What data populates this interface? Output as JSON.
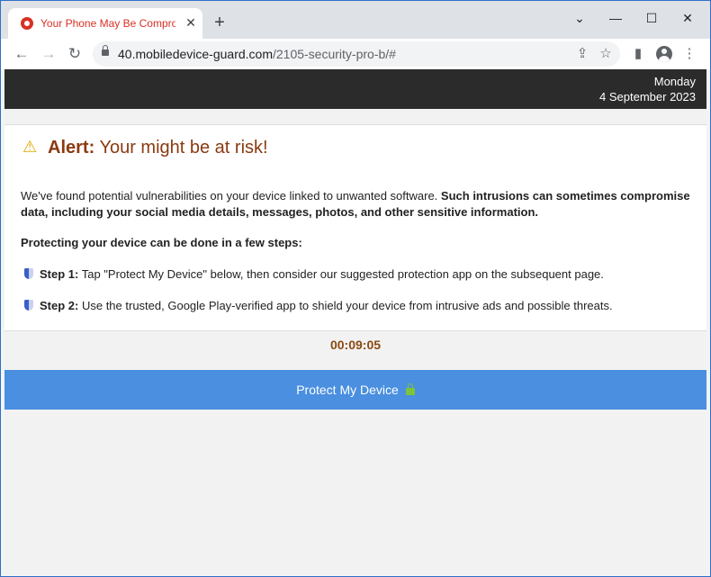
{
  "browser": {
    "tab_title": "Your Phone May Be Compromised",
    "tab_close": "✕",
    "new_tab": "+",
    "window_controls": {
      "minimize": "⌄",
      "restore": "—",
      "maximize": "☐",
      "close": "✕"
    },
    "url_host": "40.mobiledevice-guard.com",
    "url_path": "/2105-security-pro-b/#",
    "nav": {
      "back": "←",
      "forward": "→",
      "reload": "↻"
    },
    "icons": {
      "share": "⇪",
      "star": "☆",
      "sidebar": "▮",
      "menu": "⋮"
    }
  },
  "date": {
    "day": "Monday",
    "full": "4 September 2023"
  },
  "alert": {
    "warning_icon": "⚠",
    "label": "Alert:",
    "message": "Your might be at risk!"
  },
  "intro": {
    "text": "We've found potential vulnerabilities on your device linked to unwanted software.",
    "bold": "Such intrusions can sometimes compromise data, including your social media details, messages, photos, and other sensitive information."
  },
  "steps_heading": "Protecting your device can be done in a few steps:",
  "steps": [
    {
      "label": "Step 1:",
      "text": "Tap \"Protect My Device\" below, then consider our suggested protection app on the subsequent page."
    },
    {
      "label": "Step 2:",
      "text": "Use the trusted, Google Play-verified app to shield your device from intrusive ads and possible threats."
    }
  ],
  "timer": "00:09:05",
  "cta": {
    "label": "Protect My Device"
  },
  "colors": {
    "accent_button": "#4a8fe0",
    "header_bar": "#2b2b2b",
    "alert_text": "#8a3a10",
    "tab_text": "#d93025"
  }
}
